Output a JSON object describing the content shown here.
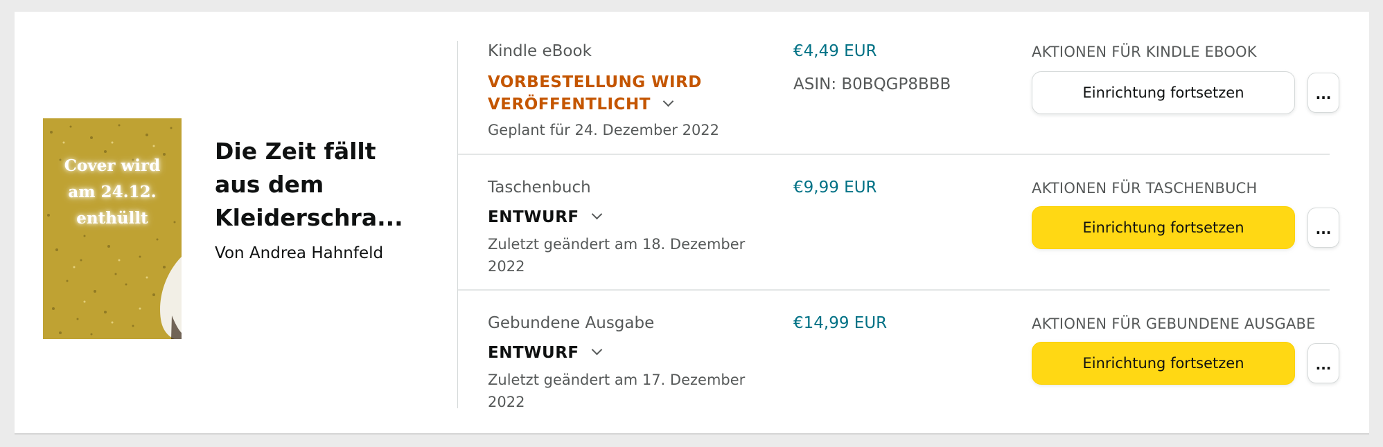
{
  "book": {
    "cover_lines": [
      "Cover wird",
      "am 24.12.",
      "enthüllt"
    ],
    "title": "Die Zeit fällt aus dem Kleiderschra...",
    "author": "Von Andrea Hahnfeld"
  },
  "formats": [
    {
      "name": "Kindle eBook",
      "status": "VORBESTELLUNG WIRD VERÖFFENTLICHT",
      "date": "Geplant für 24. Dezember 2022",
      "price": "€4,49 EUR",
      "asin": "ASIN: B0BQGP8BBB",
      "actions_label": "AKTIONEN FÜR KINDLE EBOOK",
      "button_label": "Einrichtung fortsetzen",
      "more_label": "..."
    },
    {
      "name": "Taschenbuch",
      "status": "ENTWURF",
      "date": "Zuletzt geändert am 18. Dezember 2022",
      "price": "€9,99 EUR",
      "actions_label": "AKTIONEN FÜR TASCHENBUCH",
      "button_label": "Einrichtung fortsetzen",
      "more_label": "..."
    },
    {
      "name": "Gebundene Ausgabe",
      "status": "ENTWURF",
      "date": "Zuletzt geändert am 17. Dezember 2022",
      "price": "€14,99 EUR",
      "actions_label": "AKTIONEN FÜR GEBUNDENE AUSGABE",
      "button_label": "Einrichtung fortsetzen",
      "more_label": "..."
    }
  ],
  "colors": {
    "status_preorder": "#c45500",
    "price": "#007185",
    "primary_button": "#ffd814",
    "cover_background": "#bfa233"
  }
}
